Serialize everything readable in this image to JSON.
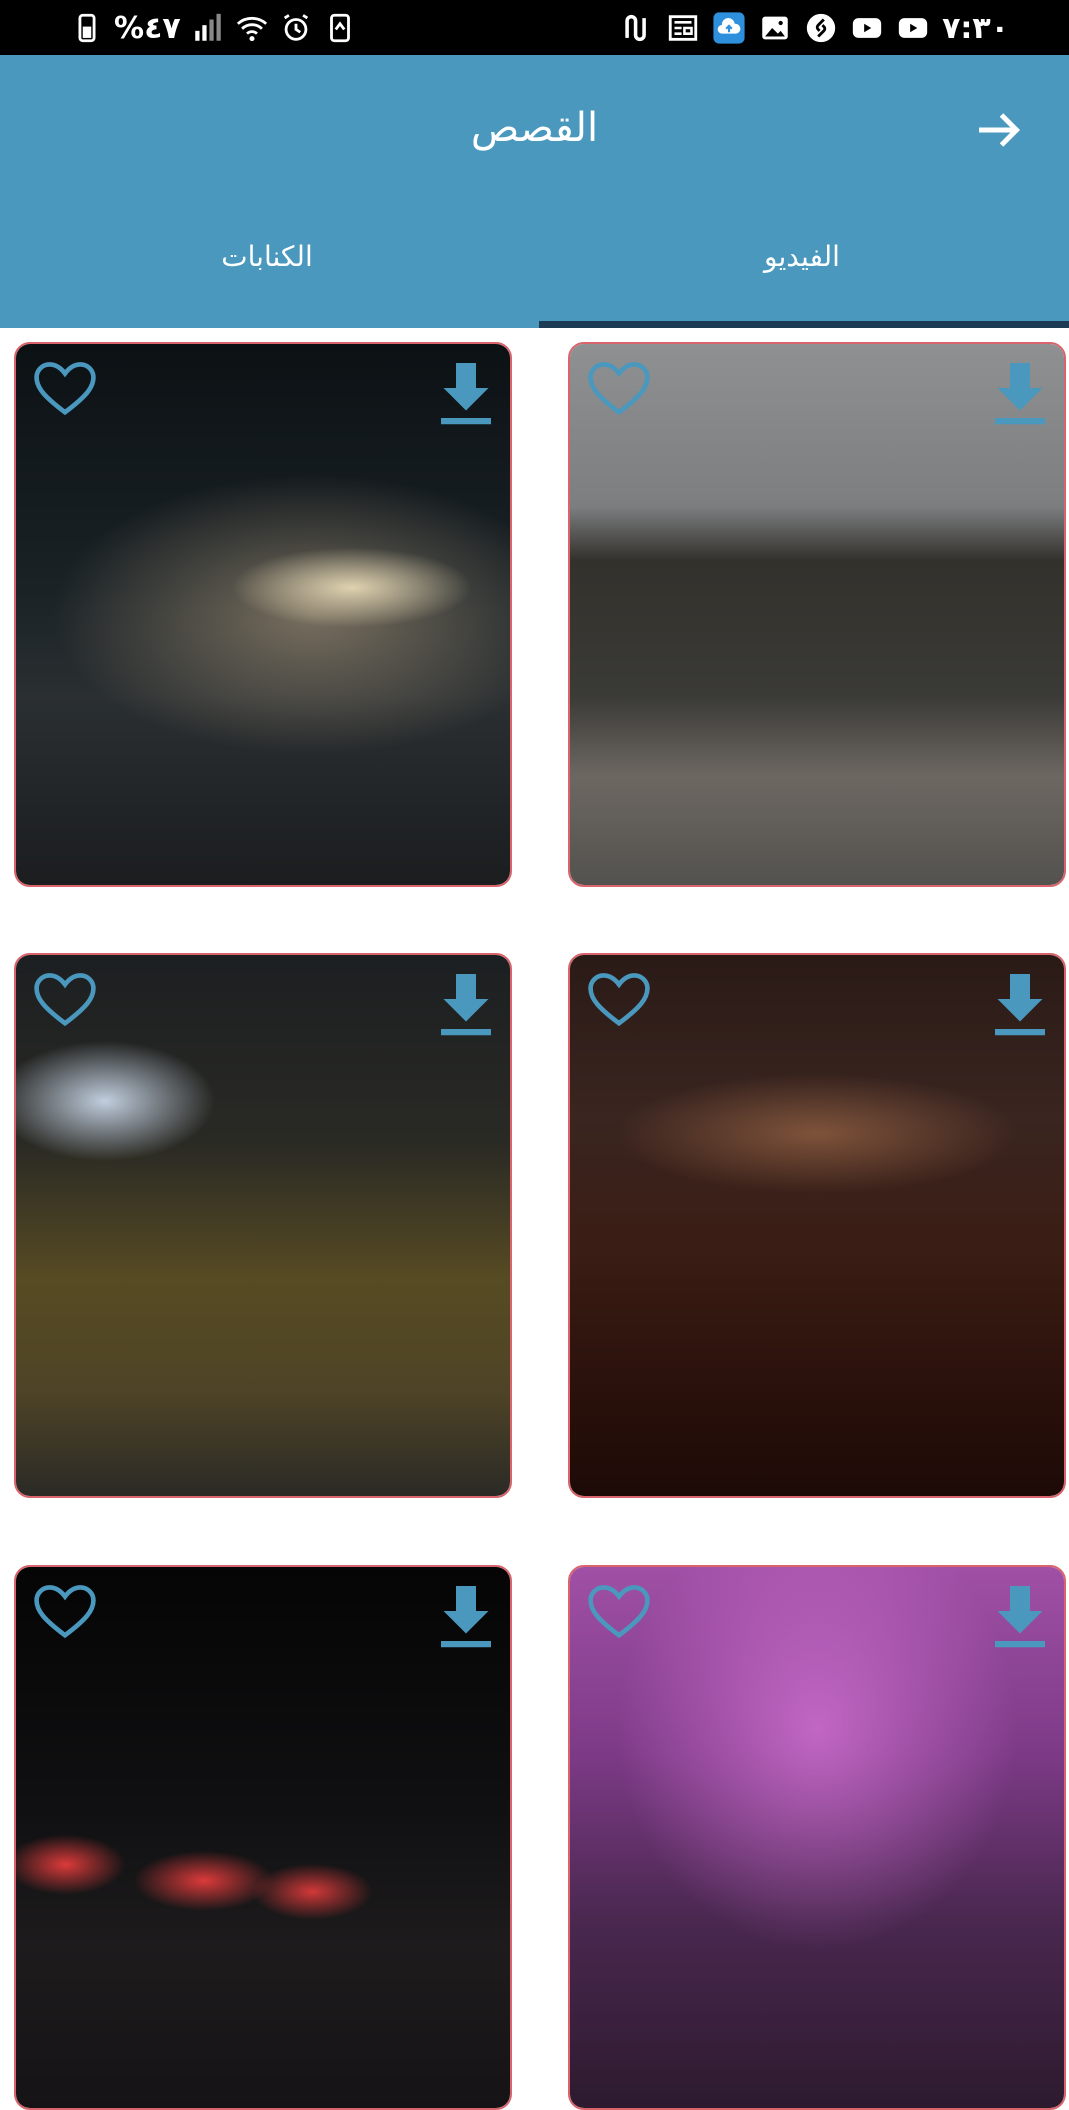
{
  "status_bar": {
    "battery": "%٤٧",
    "time": "٧:٣٠"
  },
  "header": {
    "title": "القصص"
  },
  "tabs": [
    {
      "label": "الفيديو",
      "selected": true
    },
    {
      "label": "الكنابات",
      "selected": false
    }
  ],
  "colors": {
    "app_bar": "#4a98be",
    "accent": "#4a98be",
    "tab_indicator": "#1d3a55",
    "card_border": "#d9646c"
  },
  "cards": [
    {
      "icon_favorite": "heart-outline-icon",
      "icon_download": "download-icon"
    },
    {
      "icon_favorite": "heart-outline-icon",
      "icon_download": "download-icon"
    },
    {
      "icon_favorite": "heart-outline-icon",
      "icon_download": "download-icon"
    },
    {
      "icon_favorite": "heart-outline-icon",
      "icon_download": "download-icon"
    },
    {
      "icon_favorite": "heart-outline-icon",
      "icon_download": "download-icon"
    },
    {
      "icon_favorite": "heart-outline-icon",
      "icon_download": "download-icon"
    }
  ]
}
